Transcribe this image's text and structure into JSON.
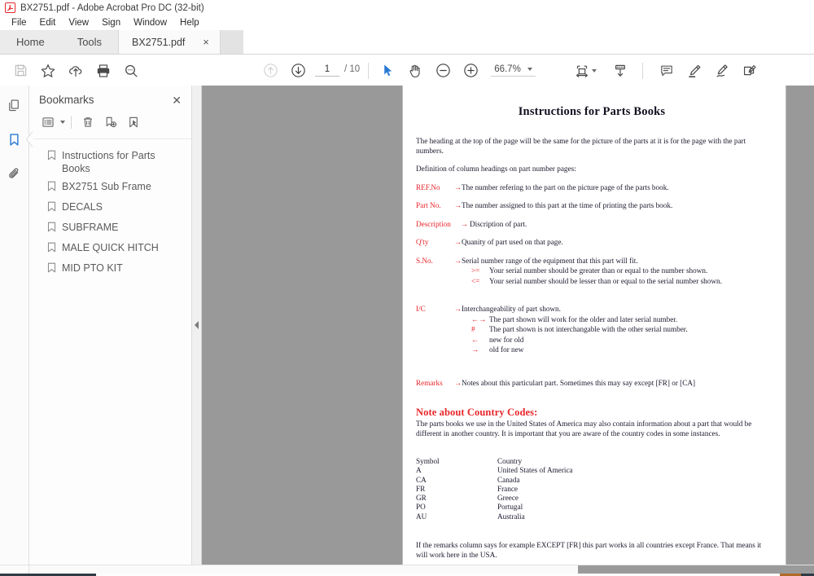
{
  "window": {
    "title": "BX2751.pdf - Adobe Acrobat Pro DC (32-bit)",
    "app_icon": "acrobat-icon"
  },
  "menubar": {
    "items": [
      {
        "label": "File"
      },
      {
        "label": "Edit"
      },
      {
        "label": "View"
      },
      {
        "label": "Sign"
      },
      {
        "label": "Window"
      },
      {
        "label": "Help"
      }
    ]
  },
  "tabs": {
    "home_label": "Home",
    "tools_label": "Tools",
    "document_label": "BX2751.pdf",
    "close_label": "×"
  },
  "toolbar": {
    "left_buttons": [
      {
        "name": "save-icon",
        "label": "Save"
      },
      {
        "name": "star-icon",
        "label": "Add to favorites"
      },
      {
        "name": "cloud-upload-icon",
        "label": "Save to cloud"
      },
      {
        "name": "print-icon",
        "label": "Print file"
      },
      {
        "name": "search-icon",
        "label": "Find text"
      }
    ],
    "page_up_label": "Previous page",
    "page_down_label": "Next page",
    "page_current": "1",
    "page_total": "/ 10",
    "select_tool_label": "Select tool",
    "hand_tool_label": "Hand tool",
    "zoom_out_label": "Zoom out",
    "zoom_in_label": "Zoom in",
    "zoom_value": "66.7%",
    "fit_label": "Fit page width",
    "scroll_mode_label": "Page display",
    "comment_label": "Add comment",
    "highlight_label": "Highlight text",
    "draw_label": "Draw free form",
    "fill_sign_label": "Fill & Sign"
  },
  "rail": {
    "items": [
      {
        "name": "page-thumbnails-icon",
        "label": "Page Thumbnails",
        "active": false
      },
      {
        "name": "bookmarks-icon",
        "label": "Bookmarks",
        "active": true
      },
      {
        "name": "attachments-icon",
        "label": "Attachments",
        "active": false
      }
    ]
  },
  "bookmarks": {
    "panel_title": "Bookmarks",
    "close_label": "✕",
    "tools": [
      {
        "name": "bookmark-options-list-icon",
        "label": "Options"
      },
      {
        "name": "delete-bookmark-icon",
        "label": "Delete bookmark"
      },
      {
        "name": "new-bookmark-icon",
        "label": "New bookmark"
      },
      {
        "name": "bookmark-target-icon",
        "label": "Set destination"
      }
    ],
    "items": [
      {
        "label": "Instructions for Parts Books"
      },
      {
        "label": "BX2751 Sub Frame"
      },
      {
        "label": "DECALS"
      },
      {
        "label": "SUBFRAME"
      },
      {
        "label": "MALE QUICK HITCH"
      },
      {
        "label": "MID PTO KIT"
      }
    ]
  },
  "document": {
    "title": "Instructions for Parts Books",
    "intro1": "The heading at the top of the page will be the same for the picture of the parts at it is for the page with the part numbers.",
    "intro2": "Definition of column headings on part number pages:",
    "definitions": [
      {
        "label": "REF.No",
        "arrow": "→",
        "desc": "The number refering to the part on the picture page of the parts book."
      },
      {
        "label": "Part No.",
        "arrow": "→",
        "desc": "The number assigned to this part at the time of printing the parts book."
      },
      {
        "label": "Description",
        "arrow": "→",
        "desc": "Discription of part."
      },
      {
        "label": "Q'ty",
        "arrow": "→",
        "desc": "Quanity of part used on that page."
      }
    ],
    "serial": {
      "label": "S.No.",
      "arrow": "→",
      "desc": "Serial number range of the equipment that this part will fit.",
      "rules": [
        {
          "sym": ">=",
          "text": "Your serial number should be greater than or equal to the number shown."
        },
        {
          "sym": "<=",
          "text": "Your serial number should be lesser than or equal to the serial number shown."
        }
      ]
    },
    "interchange": {
      "label": "I/C",
      "arrow": "→",
      "desc": "Interchangeability of part shown.",
      "rules": [
        {
          "sym": "←→",
          "text": "The part shown will work for the older and later serial number."
        },
        {
          "sym": "#",
          "text": "The part shown is not interchangable with the other serial number."
        },
        {
          "sym": "←",
          "text": "new for old"
        },
        {
          "sym": "→",
          "text": "old for new"
        }
      ]
    },
    "remarks": {
      "label": "Remarks",
      "arrow": "→",
      "desc": "Notes about this particulart part. Sometimes this may say except [FR] or [CA]"
    },
    "country_note": {
      "heading": "Note about Country Codes:",
      "body": "The parts books we use in the United States of America may also contain information about a part that would be different in another country. It is important that you are aware of the country codes in some instances."
    },
    "country_table": {
      "header": {
        "symbol": "Symbol",
        "country": "Country"
      },
      "rows": [
        {
          "symbol": "A",
          "country": "United States of America"
        },
        {
          "symbol": "CA",
          "country": "Canada"
        },
        {
          "symbol": "FR",
          "country": "France"
        },
        {
          "symbol": "GR",
          "country": "Greece"
        },
        {
          "symbol": "PO",
          "country": "Portugal"
        },
        {
          "symbol": "AU",
          "country": "Australia"
        }
      ]
    },
    "closing": "If the remarks column says for example EXCEPT [FR] this part works in all countries except France. That means it will work here in the USA."
  },
  "colors": {
    "accent_red": "#e8252a",
    "active_blue": "#2a7ad4",
    "viewport_grey": "#999999"
  }
}
